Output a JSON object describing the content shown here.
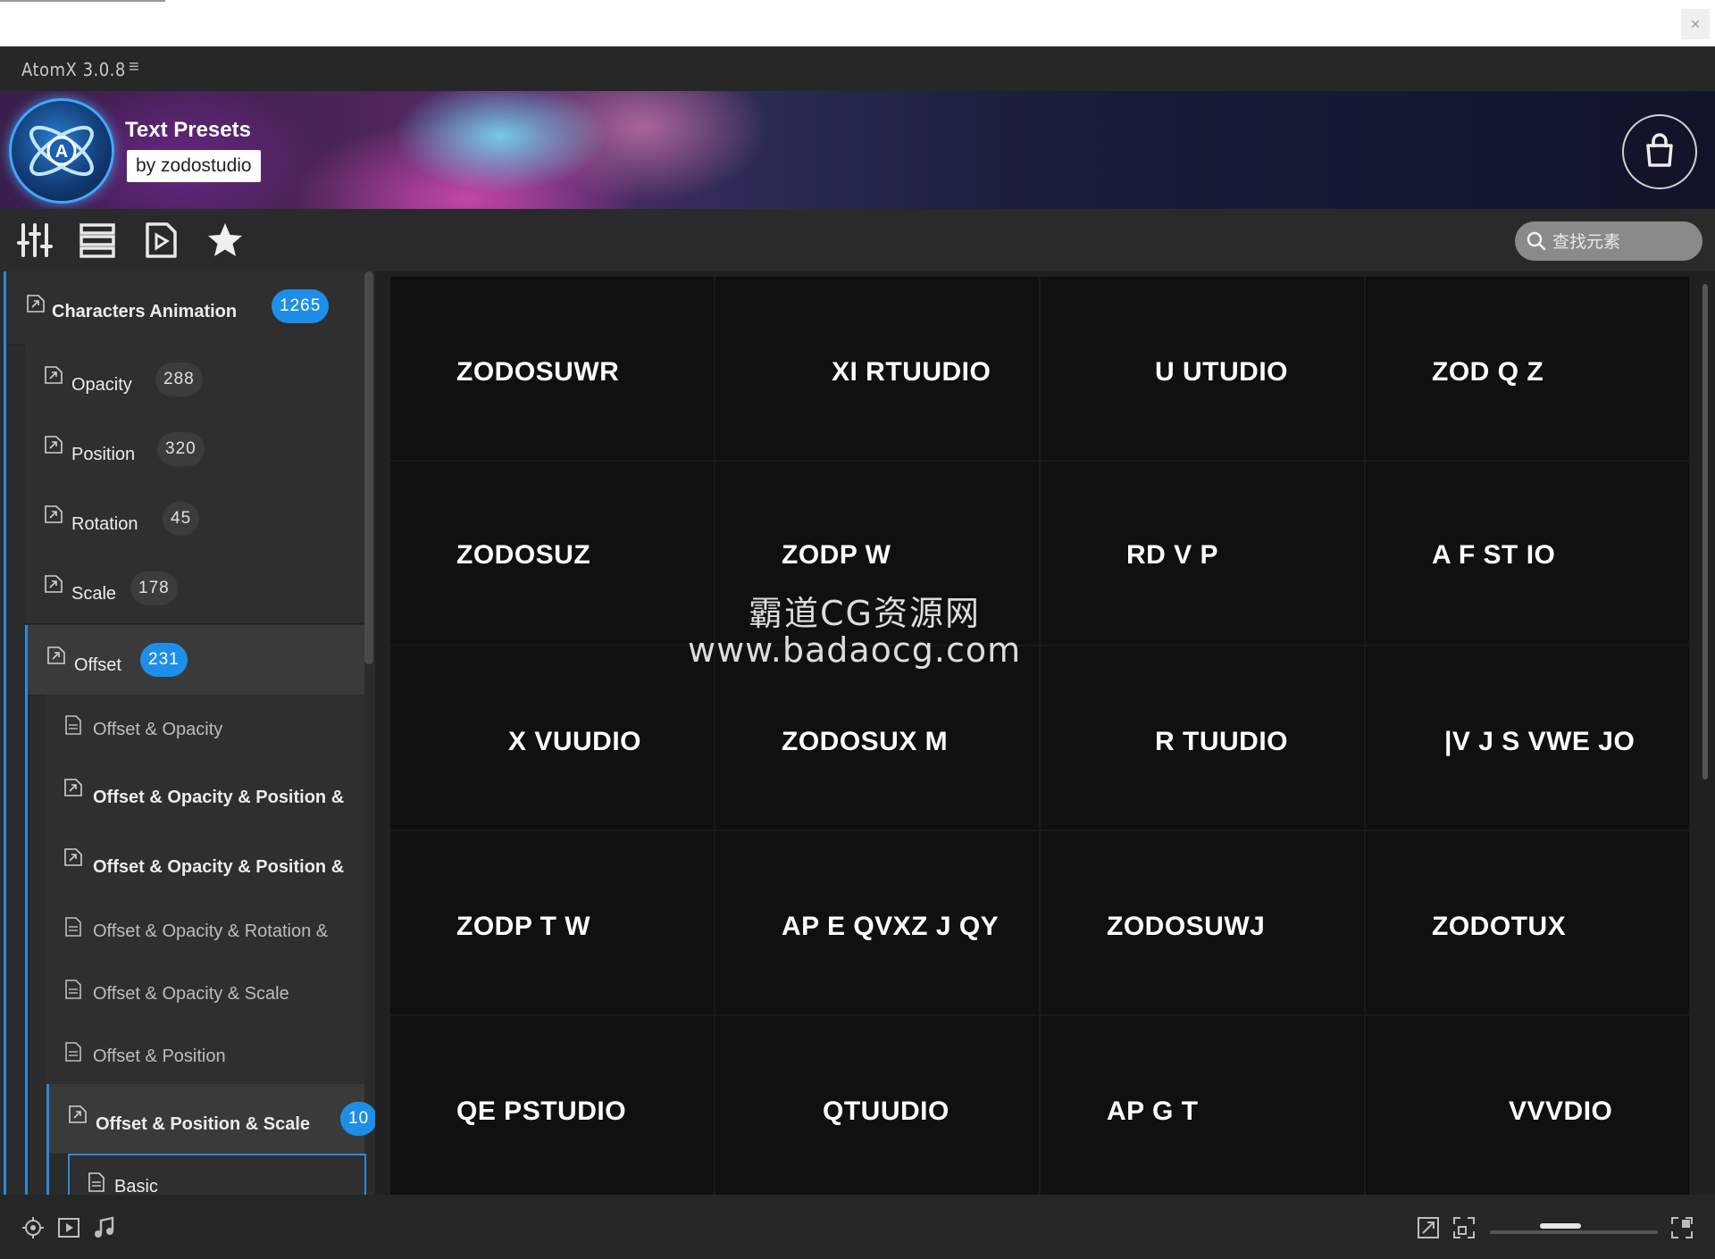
{
  "app": {
    "title": "AtomX 3.0.8"
  },
  "banner": {
    "title": "Text Presets",
    "byline": "by zodostudio"
  },
  "search": {
    "placeholder": "查找元素"
  },
  "sidebar": {
    "category": {
      "label": "Characters Animation",
      "count": "1265"
    },
    "items": [
      {
        "label": "Opacity",
        "count": "288"
      },
      {
        "label": "Position",
        "count": "320"
      },
      {
        "label": "Rotation",
        "count": "45"
      },
      {
        "label": "Scale",
        "count": "178"
      }
    ],
    "offset": {
      "label": "Offset",
      "count": "231"
    },
    "offset_children": [
      {
        "label": "Offset & Opacity"
      },
      {
        "label": "Offset & Opacity & Position &"
      },
      {
        "label": "Offset & Opacity & Position &"
      },
      {
        "label": "Offset & Opacity & Rotation &"
      },
      {
        "label": "Offset & Opacity & Scale"
      },
      {
        "label": "Offset & Position"
      }
    ],
    "expanded": {
      "label": "Offset & Position & Scale",
      "count": "10"
    },
    "expanded_children": [
      {
        "label": "Basic"
      }
    ]
  },
  "presets": [
    [
      "ZODOSUWR",
      "XI RTUUDIO",
      "U  UTUDIO",
      "ZOD Q  Z"
    ],
    [
      "ZODOSUZ",
      "ZODP W",
      "RD   V   P",
      "A  F  ST   IO"
    ],
    [
      "X  VUUDIO",
      "ZODOSUX  M",
      "R TUUDIO",
      "|V J S VWE JO"
    ],
    [
      "ZODP T W",
      "AP E QVXZ J QY",
      "ZODOSUWJ",
      "ZODOTUX"
    ],
    [
      "QE PSTUDIO",
      "QTUUDIO",
      "AP G T",
      "VVVDIO"
    ]
  ],
  "watermark": {
    "line1": "霸道CG资源网",
    "line2": "www.badaocg.com"
  },
  "icons": {
    "toolbar": [
      "sliders-icon",
      "list-icon",
      "play-file-icon",
      "star-icon"
    ],
    "bottom": [
      "crosshair-icon",
      "play-icon",
      "music-icon",
      "expand-icon",
      "fit-icon",
      "fullscreen-icon"
    ]
  },
  "colors": {
    "accent": "#1e8fe8",
    "grid_bg": "#101010",
    "sidebar_bg": "#2f2f2f"
  }
}
